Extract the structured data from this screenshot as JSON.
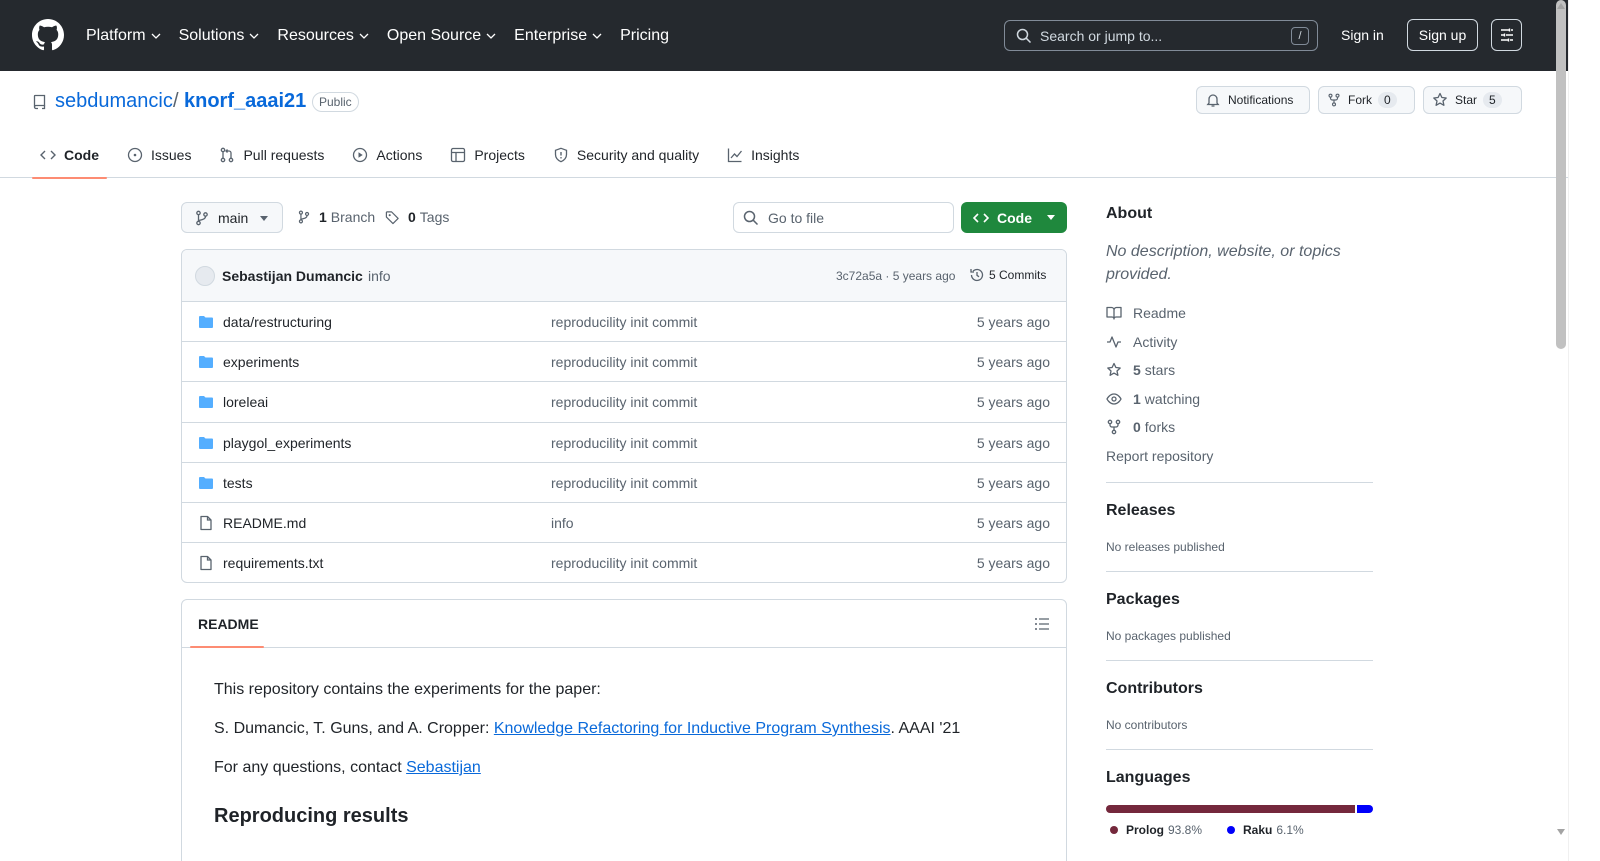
{
  "nav": {
    "items": [
      "Platform",
      "Solutions",
      "Resources",
      "Open Source",
      "Enterprise",
      "Pricing"
    ],
    "search_placeholder": "Search or jump to...",
    "search_key": "/",
    "signin": "Sign in",
    "signup": "Sign up"
  },
  "repo": {
    "owner": "sebdumancic",
    "separator": "/",
    "name": "knorf_aaai21",
    "visibility": "Public",
    "notifications_label": "Notifications",
    "fork_label": "Fork",
    "fork_count": "0",
    "star_label": "Star",
    "star_count": "5"
  },
  "tabs": [
    {
      "label": "Code",
      "icon": "code-icon",
      "active": true
    },
    {
      "label": "Issues",
      "icon": "issue-icon"
    },
    {
      "label": "Pull requests",
      "icon": "pull-request-icon"
    },
    {
      "label": "Actions",
      "icon": "play-icon"
    },
    {
      "label": "Projects",
      "icon": "table-icon"
    },
    {
      "label": "Security and quality",
      "icon": "shield-icon"
    },
    {
      "label": "Insights",
      "icon": "graph-icon"
    }
  ],
  "toolbar": {
    "branch": "main",
    "branch_count": "1",
    "branch_label": "Branch",
    "tag_count": "0",
    "tag_label": "Tags",
    "goto_placeholder": "Go to file",
    "code_label": "Code"
  },
  "commit": {
    "author": "Sebastijan Dumancic",
    "message": "info",
    "hash_time": "3c72a5a · 5 years ago",
    "commits_label": "5 Commits"
  },
  "files": [
    {
      "name": "data/restructuring",
      "type": "folder",
      "message": "reproducility init commit",
      "age": "5 years ago"
    },
    {
      "name": "experiments",
      "type": "folder",
      "message": "reproducility init commit",
      "age": "5 years ago"
    },
    {
      "name": "loreleai",
      "type": "folder",
      "message": "reproducility init commit",
      "age": "5 years ago"
    },
    {
      "name": "playgol_experiments",
      "type": "folder",
      "message": "reproducility init commit",
      "age": "5 years ago"
    },
    {
      "name": "tests",
      "type": "folder",
      "message": "reproducility init commit",
      "age": "5 years ago"
    },
    {
      "name": "README.md",
      "type": "file",
      "message": "info",
      "age": "5 years ago"
    },
    {
      "name": "requirements.txt",
      "type": "file",
      "message": "reproducility init commit",
      "age": "5 years ago"
    }
  ],
  "readme": {
    "tab": "README",
    "p1": "This repository contains the experiments for the paper:",
    "p2_prefix": "S. Dumancic, T. Guns, and A. Cropper: ",
    "p2_link": "Knowledge Refactoring for Inductive Program Synthesis",
    "p2_suffix": ". AAAI '21",
    "p3_prefix": "For any questions, contact ",
    "p3_link": "Sebastijan",
    "h2": "Reproducing results"
  },
  "sidebar": {
    "about_title": "About",
    "about_desc": "No description, website, or topics provided.",
    "readme": "Readme",
    "activity": "Activity",
    "stars_count": "5",
    "stars_label": "stars",
    "watching_count": "1",
    "watching_label": "watching",
    "forks_count": "0",
    "forks_label": "forks",
    "report": "Report repository",
    "releases_title": "Releases",
    "releases_desc": "No releases published",
    "packages_title": "Packages",
    "packages_desc": "No packages published",
    "contributors_title": "Contributors",
    "contributors_desc": "No contributors",
    "languages_title": "Languages",
    "languages": [
      {
        "name": "Prolog",
        "pct": "93.8%",
        "value": 93.8,
        "color": "#74283c"
      },
      {
        "name": "Raku",
        "pct": "6.1%",
        "value": 6.1,
        "color": "#0000fb"
      }
    ]
  },
  "colors": {
    "header_bg": "#25292e",
    "link": "#0969da",
    "primary_button": "#1f883d",
    "tab_underline": "#fd8c73",
    "folder": "#54aeff"
  }
}
